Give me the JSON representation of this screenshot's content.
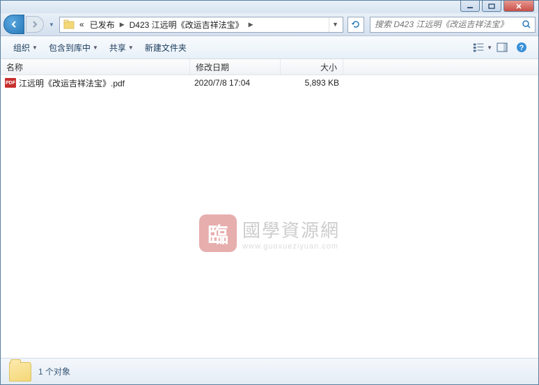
{
  "breadcrumb": {
    "chevrons": "«",
    "items": [
      "已发布",
      "D423 江远明《改运吉祥法宝》"
    ]
  },
  "search": {
    "placeholder": "搜索 D423 江远明《改运吉祥法宝》"
  },
  "toolbar": {
    "organize": "组织",
    "include": "包含到库中",
    "share": "共享",
    "newfolder": "新建文件夹"
  },
  "columns": {
    "name": "名称",
    "modified": "修改日期",
    "size": "大小"
  },
  "files": [
    {
      "icon_label": "PDF",
      "name": "江远明《改运吉祥法宝》.pdf",
      "modified": "2020/7/8 17:04",
      "size": "5,893 KB"
    }
  ],
  "watermark": {
    "icon": "臨",
    "main": "國學資源網",
    "sub": "www.guoxueziyuan.com"
  },
  "status": {
    "text": "1 个对象"
  }
}
